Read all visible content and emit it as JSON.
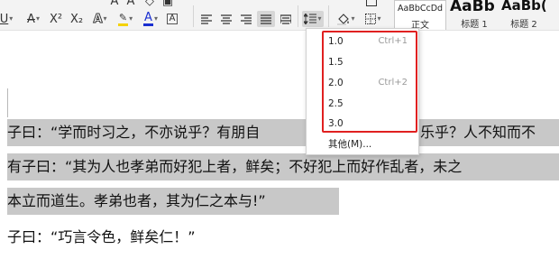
{
  "toolbar": {
    "strike_glyph": "A",
    "superscript": "X²",
    "subscript": "X₂",
    "font_color_glyph": "A",
    "highlight_glyph": "A",
    "char_border_glyph": "A"
  },
  "styles": [
    {
      "preview": "AaBbCcDd",
      "name": "正文"
    },
    {
      "preview": "AaBb",
      "name": "标题 1"
    },
    {
      "preview": "AaBb(",
      "name": "标题 2"
    }
  ],
  "colors": {
    "font_color": "#1a2fd0",
    "highlight_color": "#f5d200",
    "highlight_box": "#e02020",
    "selection": "#c8c8c8"
  },
  "line_spacing_menu": {
    "options": [
      {
        "value": "1.0",
        "shortcut": "Ctrl+1"
      },
      {
        "value": "1.5",
        "shortcut": ""
      },
      {
        "value": "2.0",
        "shortcut": "Ctrl+2"
      },
      {
        "value": "2.5",
        "shortcut": ""
      },
      {
        "value": "3.0",
        "shortcut": ""
      }
    ],
    "other_label": "其他(M)..."
  },
  "document": {
    "lines": [
      {
        "left": "子曰：“学而时习之，不亦说乎？有朋自",
        "right": "乐乎？人不知而不"
      },
      {
        "left": "有子曰：“其为人也孝弟而好犯上者，鲜矣；不好犯上而好作乱者，未之",
        "right": ""
      },
      {
        "left": "本立而道生。孝弟也者，其为仁之本与!”",
        "right": ""
      },
      {
        "left": "子曰：“巧言令色，鲜矣仁！”",
        "right": ""
      }
    ]
  }
}
